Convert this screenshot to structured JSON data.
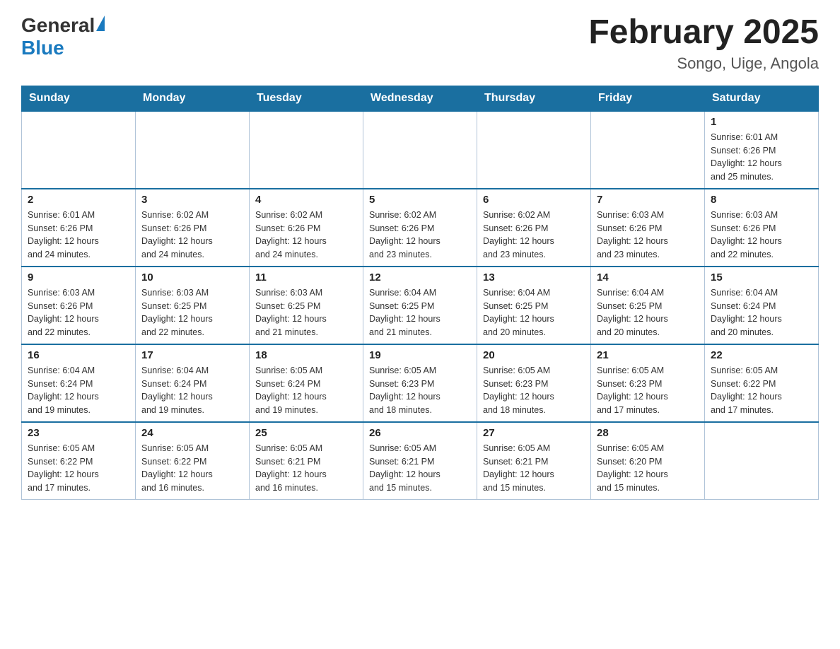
{
  "header": {
    "logo_general": "General",
    "logo_blue": "Blue",
    "title": "February 2025",
    "subtitle": "Songo, Uige, Angola"
  },
  "weekdays": [
    "Sunday",
    "Monday",
    "Tuesday",
    "Wednesday",
    "Thursday",
    "Friday",
    "Saturday"
  ],
  "weeks": [
    [
      {
        "day": "",
        "info": ""
      },
      {
        "day": "",
        "info": ""
      },
      {
        "day": "",
        "info": ""
      },
      {
        "day": "",
        "info": ""
      },
      {
        "day": "",
        "info": ""
      },
      {
        "day": "",
        "info": ""
      },
      {
        "day": "1",
        "info": "Sunrise: 6:01 AM\nSunset: 6:26 PM\nDaylight: 12 hours\nand 25 minutes."
      }
    ],
    [
      {
        "day": "2",
        "info": "Sunrise: 6:01 AM\nSunset: 6:26 PM\nDaylight: 12 hours\nand 24 minutes."
      },
      {
        "day": "3",
        "info": "Sunrise: 6:02 AM\nSunset: 6:26 PM\nDaylight: 12 hours\nand 24 minutes."
      },
      {
        "day": "4",
        "info": "Sunrise: 6:02 AM\nSunset: 6:26 PM\nDaylight: 12 hours\nand 24 minutes."
      },
      {
        "day": "5",
        "info": "Sunrise: 6:02 AM\nSunset: 6:26 PM\nDaylight: 12 hours\nand 23 minutes."
      },
      {
        "day": "6",
        "info": "Sunrise: 6:02 AM\nSunset: 6:26 PM\nDaylight: 12 hours\nand 23 minutes."
      },
      {
        "day": "7",
        "info": "Sunrise: 6:03 AM\nSunset: 6:26 PM\nDaylight: 12 hours\nand 23 minutes."
      },
      {
        "day": "8",
        "info": "Sunrise: 6:03 AM\nSunset: 6:26 PM\nDaylight: 12 hours\nand 22 minutes."
      }
    ],
    [
      {
        "day": "9",
        "info": "Sunrise: 6:03 AM\nSunset: 6:26 PM\nDaylight: 12 hours\nand 22 minutes."
      },
      {
        "day": "10",
        "info": "Sunrise: 6:03 AM\nSunset: 6:25 PM\nDaylight: 12 hours\nand 22 minutes."
      },
      {
        "day": "11",
        "info": "Sunrise: 6:03 AM\nSunset: 6:25 PM\nDaylight: 12 hours\nand 21 minutes."
      },
      {
        "day": "12",
        "info": "Sunrise: 6:04 AM\nSunset: 6:25 PM\nDaylight: 12 hours\nand 21 minutes."
      },
      {
        "day": "13",
        "info": "Sunrise: 6:04 AM\nSunset: 6:25 PM\nDaylight: 12 hours\nand 20 minutes."
      },
      {
        "day": "14",
        "info": "Sunrise: 6:04 AM\nSunset: 6:25 PM\nDaylight: 12 hours\nand 20 minutes."
      },
      {
        "day": "15",
        "info": "Sunrise: 6:04 AM\nSunset: 6:24 PM\nDaylight: 12 hours\nand 20 minutes."
      }
    ],
    [
      {
        "day": "16",
        "info": "Sunrise: 6:04 AM\nSunset: 6:24 PM\nDaylight: 12 hours\nand 19 minutes."
      },
      {
        "day": "17",
        "info": "Sunrise: 6:04 AM\nSunset: 6:24 PM\nDaylight: 12 hours\nand 19 minutes."
      },
      {
        "day": "18",
        "info": "Sunrise: 6:05 AM\nSunset: 6:24 PM\nDaylight: 12 hours\nand 19 minutes."
      },
      {
        "day": "19",
        "info": "Sunrise: 6:05 AM\nSunset: 6:23 PM\nDaylight: 12 hours\nand 18 minutes."
      },
      {
        "day": "20",
        "info": "Sunrise: 6:05 AM\nSunset: 6:23 PM\nDaylight: 12 hours\nand 18 minutes."
      },
      {
        "day": "21",
        "info": "Sunrise: 6:05 AM\nSunset: 6:23 PM\nDaylight: 12 hours\nand 17 minutes."
      },
      {
        "day": "22",
        "info": "Sunrise: 6:05 AM\nSunset: 6:22 PM\nDaylight: 12 hours\nand 17 minutes."
      }
    ],
    [
      {
        "day": "23",
        "info": "Sunrise: 6:05 AM\nSunset: 6:22 PM\nDaylight: 12 hours\nand 17 minutes."
      },
      {
        "day": "24",
        "info": "Sunrise: 6:05 AM\nSunset: 6:22 PM\nDaylight: 12 hours\nand 16 minutes."
      },
      {
        "day": "25",
        "info": "Sunrise: 6:05 AM\nSunset: 6:21 PM\nDaylight: 12 hours\nand 16 minutes."
      },
      {
        "day": "26",
        "info": "Sunrise: 6:05 AM\nSunset: 6:21 PM\nDaylight: 12 hours\nand 15 minutes."
      },
      {
        "day": "27",
        "info": "Sunrise: 6:05 AM\nSunset: 6:21 PM\nDaylight: 12 hours\nand 15 minutes."
      },
      {
        "day": "28",
        "info": "Sunrise: 6:05 AM\nSunset: 6:20 PM\nDaylight: 12 hours\nand 15 minutes."
      },
      {
        "day": "",
        "info": ""
      }
    ]
  ]
}
